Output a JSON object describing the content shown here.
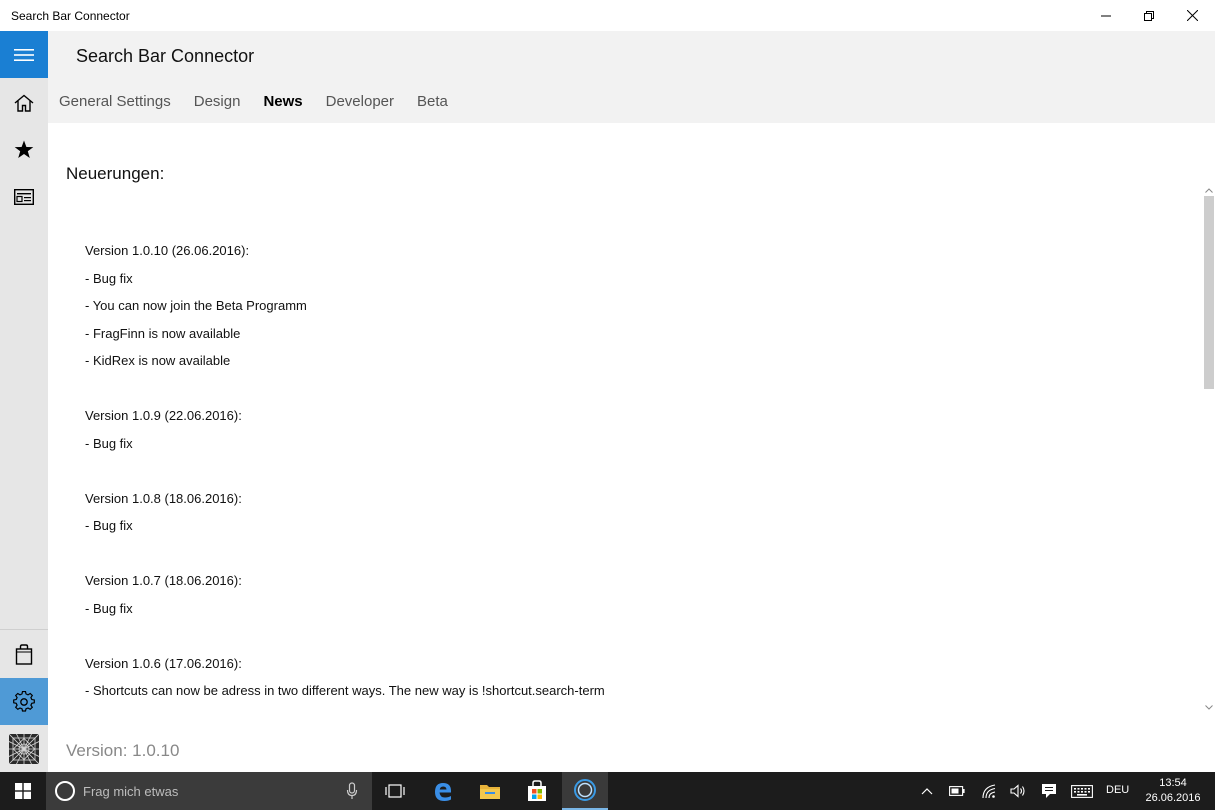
{
  "window": {
    "title": "Search Bar Connector"
  },
  "header": {
    "app_title": "Search Bar Connector",
    "tabs": [
      {
        "label": "General Settings",
        "active": false
      },
      {
        "label": "Design",
        "active": false
      },
      {
        "label": "News",
        "active": true
      },
      {
        "label": "Developer",
        "active": false
      },
      {
        "label": "Beta",
        "active": false
      }
    ]
  },
  "sidebar": {
    "items": [
      {
        "icon": "hamburger-menu-icon"
      },
      {
        "icon": "home-icon"
      },
      {
        "icon": "star-icon"
      },
      {
        "icon": "news-icon"
      },
      {
        "icon": "store-bag-icon"
      },
      {
        "icon": "gear-icon"
      },
      {
        "icon": "app-logo-icon"
      }
    ]
  },
  "content": {
    "heading": "Neuerungen:",
    "news": [
      {
        "version": "Version 1.0.10 (26.06.2016):",
        "items": [
          "- Bug fix",
          "- You can now join the Beta Programm",
          "- FragFinn is now available",
          "- KidRex is now available"
        ]
      },
      {
        "version": "Version 1.0.9 (22.06.2016):",
        "items": [
          "- Bug fix"
        ]
      },
      {
        "version": "Version 1.0.8 (18.06.2016):",
        "items": [
          "- Bug fix"
        ]
      },
      {
        "version": "Version 1.0.7 (18.06.2016):",
        "items": [
          "- Bug fix"
        ]
      },
      {
        "version": "Version 1.0.6 (17.06.2016):",
        "items": [
          "- Shortcuts can now be adress in two different ways. The new way is !shortcut.search-term"
        ]
      }
    ],
    "version_footer": "Version: 1.0.10"
  },
  "taskbar": {
    "search_placeholder": "Frag mich etwas",
    "language": "DEU",
    "time": "13:54",
    "date": "26.06.2016"
  },
  "colors": {
    "accent": "#1a7fd3",
    "settings_selected": "#4f9ad6",
    "sidebar_bg": "#e6e6e6",
    "header_bg": "#f2f2f2",
    "taskbar_bg": "#1c1c1c"
  }
}
